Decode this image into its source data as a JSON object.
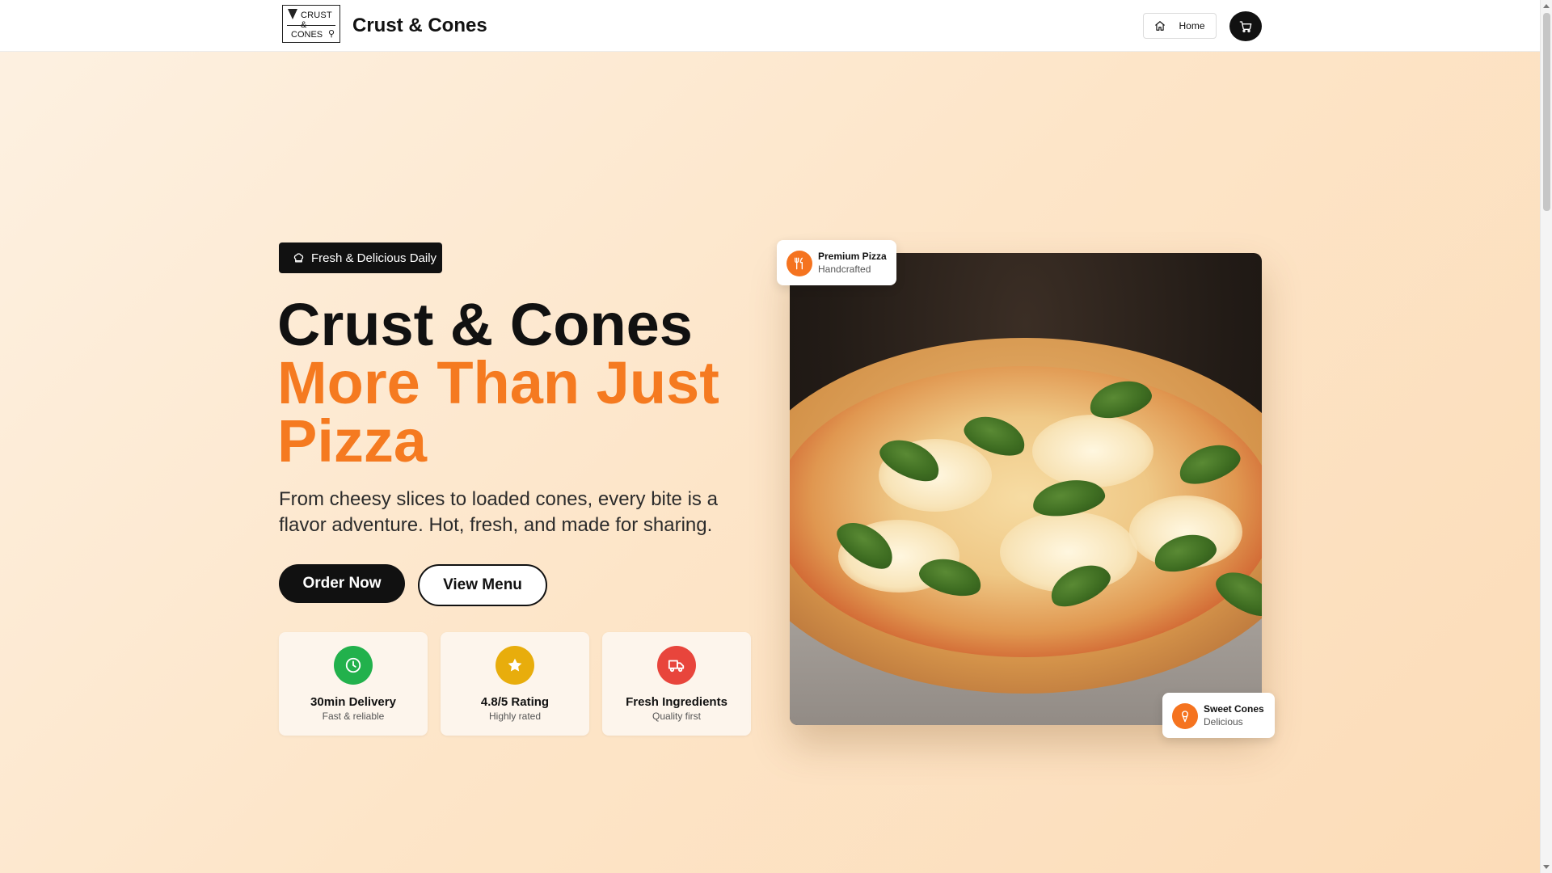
{
  "header": {
    "logo": {
      "line1": "CRUST &",
      "line2": "CONES"
    },
    "brand_name": "Crust & Cones",
    "home_label": "Home"
  },
  "hero": {
    "tag_label": "Fresh & Delicious Daily",
    "title_line1": "Crust & Cones",
    "title_accent": "More Than Just Pizza",
    "subtitle": "From cheesy slices to loaded cones, every bite is a flavor adventure. Hot, fresh, and made for sharing.",
    "order_button": "Order Now",
    "menu_button": "View Menu"
  },
  "features": [
    {
      "title": "30min Delivery",
      "subtitle": "Fast & reliable",
      "icon": "clock-icon",
      "color": "#22b14c"
    },
    {
      "title": "4.8/5 Rating",
      "subtitle": "Highly rated",
      "icon": "star-icon",
      "color": "#e8ad0c"
    },
    {
      "title": "Fresh Ingredients",
      "subtitle": "Quality first",
      "icon": "truck-icon",
      "color": "#e8453c"
    }
  ],
  "badges": {
    "top": {
      "title": "Premium Pizza",
      "subtitle": "Handcrafted",
      "icon": "utensils-icon"
    },
    "bottom": {
      "title": "Sweet Cones",
      "subtitle": "Delicious",
      "icon": "ice-cream-icon"
    }
  },
  "colors": {
    "accent": "#f57a20",
    "dark": "#111111",
    "background": "#fde5c8"
  }
}
